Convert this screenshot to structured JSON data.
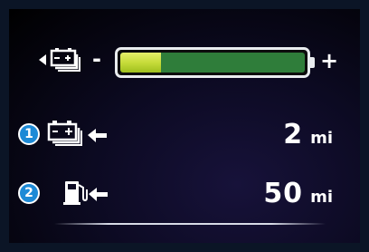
{
  "gauge": {
    "icon": "battery-stack-arrow-icon",
    "minus_label": "-",
    "plus_label": "+",
    "charge_level_percent": 22,
    "fill_color": "#c7dc3a",
    "track_color": "#2f7d3a"
  },
  "rows": [
    {
      "badge": "1",
      "icon": "battery-arrow-icon",
      "value": "2",
      "unit": "mi"
    },
    {
      "badge": "2",
      "icon": "fuel-pump-arrow-icon",
      "value": "50",
      "unit": "mi"
    }
  ],
  "colors": {
    "badge": "#1d8ad6",
    "text": "#ffffff",
    "screen_background": "#000000",
    "frame": "#0b1526"
  }
}
